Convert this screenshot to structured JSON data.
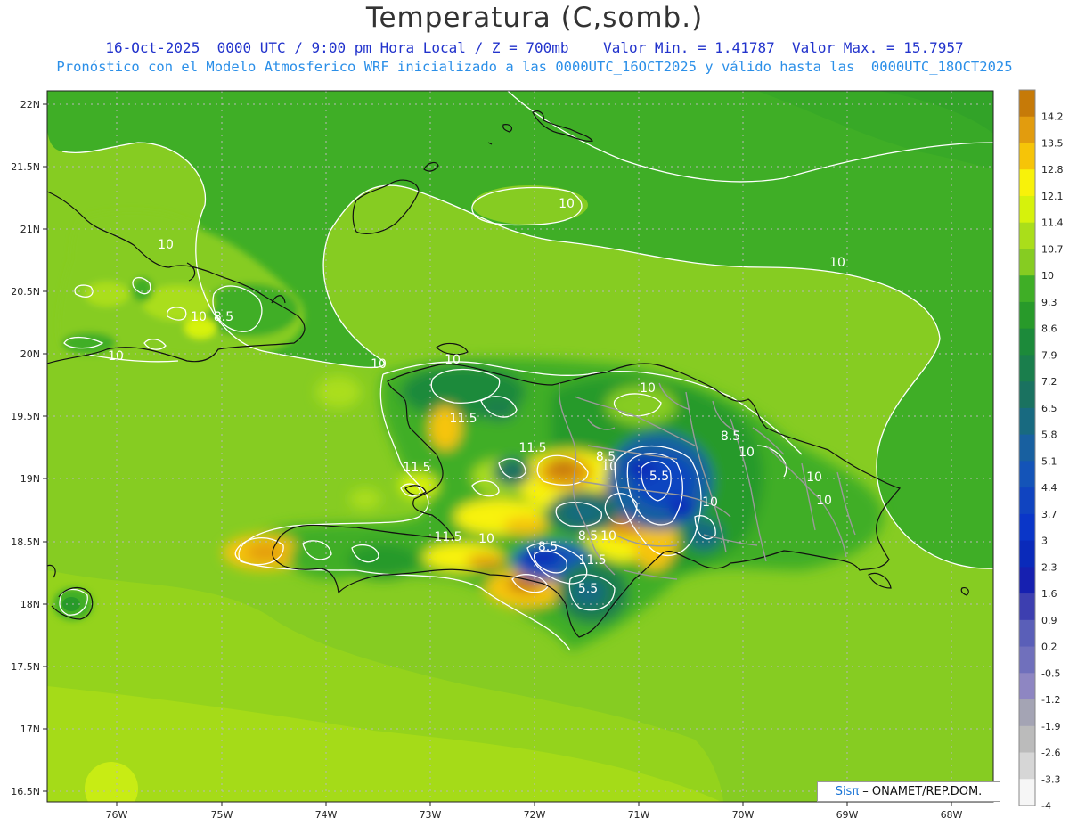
{
  "title": "Temperatura (C,somb.)",
  "subtitle1": "16-Oct-2025  0000 UTC / 9:00 pm Hora Local / Z = 700mb    Valor Min. = 1.41787  Valor Max. = 15.7957",
  "subtitle2": "Pronóstico con el Modelo Atmosferico WRF inicializado a las 0000UTC_16OCT2025 y válido hasta las  0000UTC_18OCT2025",
  "lat_labels": [
    "22N",
    "21.5N",
    "21N",
    "20.5N",
    "20N",
    "19.5N",
    "19N",
    "18.5N",
    "18N",
    "17.5N",
    "17N",
    "16.5N"
  ],
  "lon_labels": [
    "76W",
    "75W",
    "74W",
    "73W",
    "72W",
    "71W",
    "70W",
    "69W",
    "68W"
  ],
  "contour_labels": [
    "10",
    "10",
    "10",
    "10",
    "10",
    "10",
    "8.5",
    "10",
    "10",
    "11.5",
    "11.5",
    "11.5",
    "8.5",
    "10",
    "5.5",
    "10",
    "11.5",
    "10",
    "8.5",
    "8.5",
    "10",
    "11.5",
    "5.5",
    "10",
    "10",
    "10",
    "8.5"
  ],
  "colorbar": {
    "labels": [
      "14.2",
      "13.5",
      "12.8",
      "12.1",
      "11.4",
      "10.7",
      "10",
      "9.3",
      "8.6",
      "7.9",
      "7.2",
      "6.5",
      "5.8",
      "5.1",
      "4.4",
      "3.7",
      "3",
      "2.3",
      "1.6",
      "0.9",
      "0.2",
      "-0.5",
      "-1.2",
      "-1.9",
      "-2.6",
      "-3.3",
      "-4"
    ],
    "colors": [
      "#c67a08",
      "#e29c0e",
      "#f6c408",
      "#f8f20a",
      "#d6f20c",
      "#aade1a",
      "#86cc22",
      "#3fae26",
      "#289a2a",
      "#1c8a3a",
      "#1a7e4c",
      "#1a7260",
      "#186a80",
      "#1860a0",
      "#1454b8",
      "#1044c0",
      "#0a36c8",
      "#0a2aba",
      "#1620b0",
      "#3d3fb0",
      "#5a5fb8",
      "#7070bc",
      "#8e86c2",
      "#a4a4b4",
      "#bbbbbb",
      "#d6d6d6",
      "#f6f6f6"
    ]
  },
  "credit": {
    "brand": "Sisπ",
    "text": " – ONAMET/REP.DOM."
  }
}
